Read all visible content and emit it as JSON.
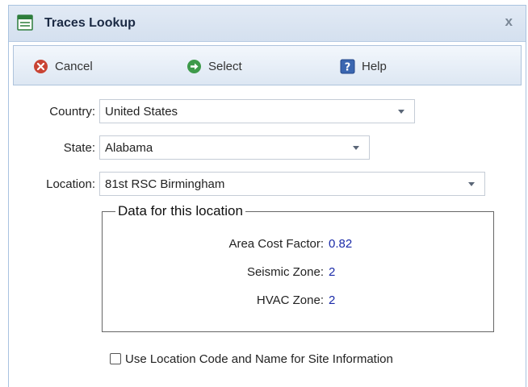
{
  "window": {
    "title": "Traces Lookup",
    "close_label": "x"
  },
  "toolbar": {
    "cancel_label": "Cancel",
    "select_label": "Select",
    "help_label": "Help"
  },
  "form": {
    "country_label": "Country:",
    "country_value": "United States",
    "state_label": "State:",
    "state_value": "Alabama",
    "location_label": "Location:",
    "location_value": "81st RSC Birmingham"
  },
  "location_data": {
    "legend": "Data for this location",
    "area_cost_factor_label": "Area Cost Factor:",
    "area_cost_factor_value": "0.82",
    "seismic_zone_label": "Seismic Zone:",
    "seismic_zone_value": "2",
    "hvac_zone_label": "HVAC Zone:",
    "hvac_zone_value": "2"
  },
  "options": {
    "use_location_code_label": "Use Location Code and Name for Site Information",
    "use_location_code_checked": false
  },
  "colors": {
    "titlebar_bg": "#d9e4f2",
    "value_text": "#1a2aa8",
    "cancel_icon": "#c0392b",
    "select_icon": "#2e8b3e",
    "help_icon": "#2d5aa0"
  },
  "icons": {
    "title": "window-icon",
    "close": "close-icon",
    "cancel": "cancel-icon",
    "select": "select-arrow-icon",
    "help": "help-icon"
  }
}
